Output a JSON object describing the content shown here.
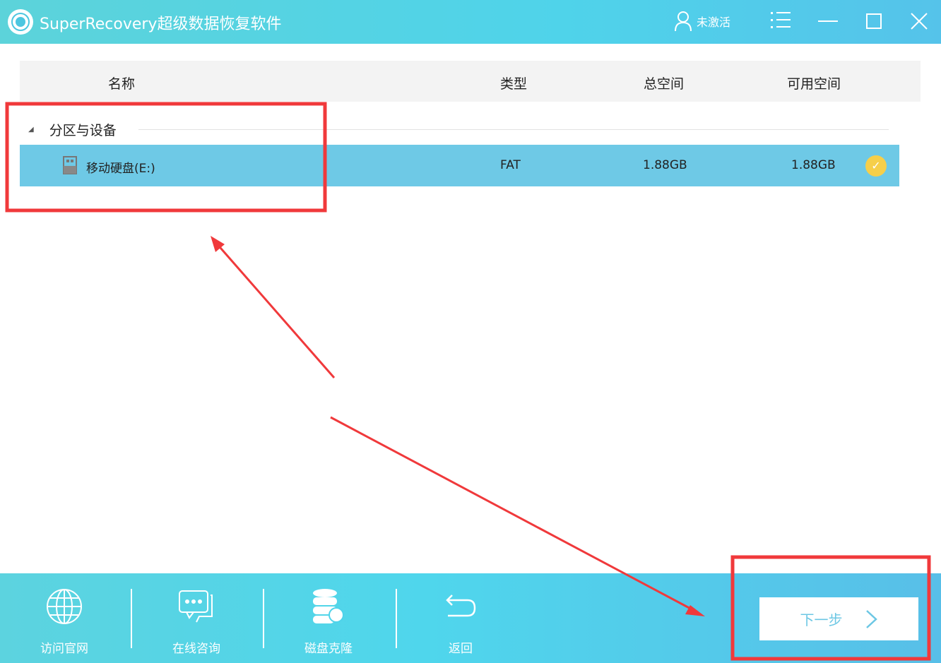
{
  "app": {
    "title": "SuperRecovery超级数据恢复软件",
    "user_status": "未激活"
  },
  "table": {
    "headers": {
      "name": "名称",
      "type": "类型",
      "total": "总空间",
      "free": "可用空间"
    },
    "group": "分区与设备",
    "rows": [
      {
        "name": "移动硬盘(E:)",
        "type": "FAT",
        "total": "1.88GB",
        "free": "1.88GB",
        "selected": true
      }
    ]
  },
  "footer": {
    "website": "访问官网",
    "chat": "在线咨询",
    "clone": "磁盘克隆",
    "back": "返回",
    "next": "下一步"
  },
  "colors": {
    "accent": "#4fd3ea",
    "selected_row": "#6ec9e6",
    "annotation": "#f0393b"
  }
}
